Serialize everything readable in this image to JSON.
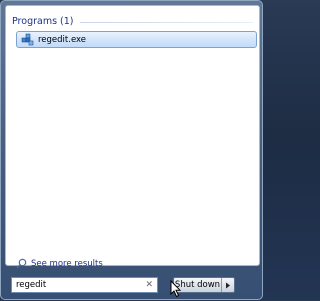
{
  "group": {
    "title": "Programs (1)"
  },
  "results": [
    {
      "label": "regedit.exe",
      "icon": "registry-editor-icon"
    }
  ],
  "more_results": {
    "label": "See more results",
    "icon": "magnifier-icon"
  },
  "search": {
    "value": "regedit",
    "clear_icon": "clear-icon"
  },
  "power": {
    "label": "Shut down",
    "arrow_icon": "right-arrow-icon"
  },
  "colors": {
    "group_title": "#1e3287",
    "selection": "#c1dbfa"
  }
}
